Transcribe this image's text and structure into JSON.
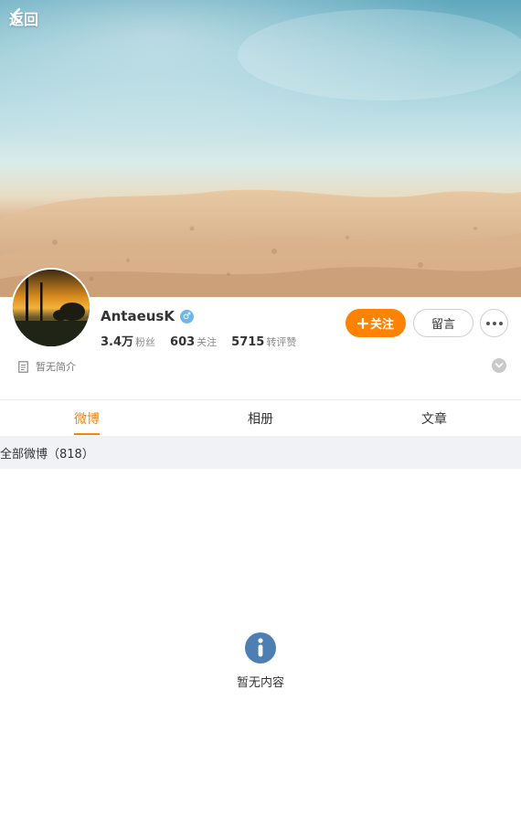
{
  "nav": {
    "back_label": "返回"
  },
  "profile": {
    "name": "AntaeusK",
    "gender_symbol": "♂",
    "stats": [
      {
        "value": "3.4万",
        "label": "粉丝"
      },
      {
        "value": "603",
        "label": "关注"
      },
      {
        "value": "5715",
        "label": "转评赞"
      }
    ],
    "intro": "暂无简介"
  },
  "actions": {
    "follow_label": "关注",
    "message_label": "留言"
  },
  "tabs": [
    {
      "label": "微博",
      "active": true
    },
    {
      "label": "相册",
      "active": false
    },
    {
      "label": "文章",
      "active": false
    }
  ],
  "filter": {
    "label": "全部微博（818）"
  },
  "empty": {
    "text": "暂无内容"
  },
  "colors": {
    "accent": "#ff8200",
    "gender_badge": "#6fb7ea",
    "info_icon": "#4d7fb3",
    "filter_bg": "#f1f2f5"
  }
}
